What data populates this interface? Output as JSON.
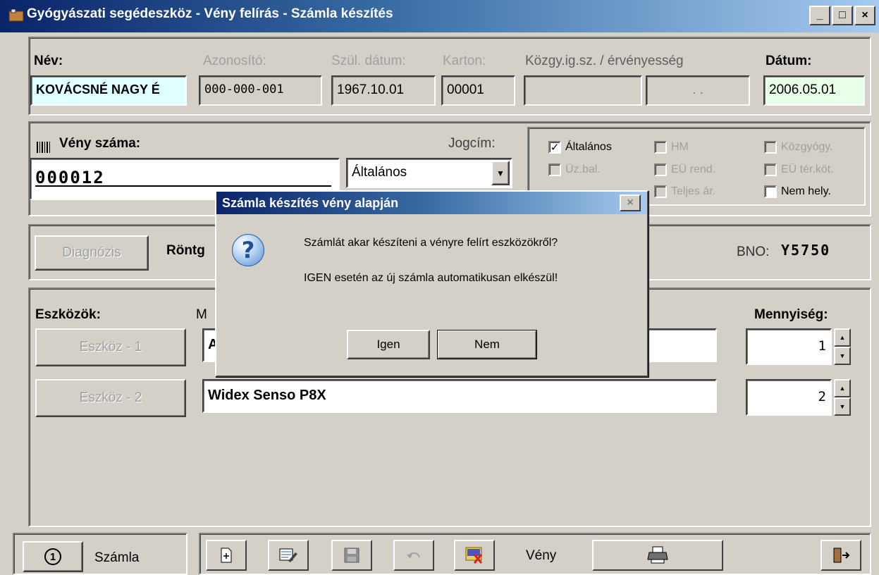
{
  "window": {
    "title": "Gyógyászati segédeszköz - Vény felírás - Számla készítés",
    "minimize_glyph": "_",
    "maximize_glyph": "□",
    "close_glyph": "×"
  },
  "patient": {
    "name_label": "Név:",
    "name_value": "KOVÁCSNÉ NAGY É",
    "id_label": "Azonosító:",
    "id_value": "000-000-001",
    "dob_label": "Szül. dátum:",
    "dob_value": "1967.10.01",
    "card_label": "Karton:",
    "card_value": "00001",
    "kozgy_label": "Közgy.ig.sz. / érvényesség",
    "kozgy_value": "",
    "kozgy_valid_value": ". .",
    "date_label": "Dátum:",
    "date_value": "2006.05.01"
  },
  "veny": {
    "number_label": "Vény száma:",
    "number_value": "000012",
    "jogcim_label": "Jogcím:",
    "jogcim_value": "Általános",
    "checkboxes": [
      {
        "label": "Általános",
        "checked": true,
        "enabled": true
      },
      {
        "label": "HM",
        "checked": false,
        "enabled": false
      },
      {
        "label": "Közgyógy.",
        "checked": false,
        "enabled": false
      },
      {
        "label": "Üz.bal.",
        "checked": false,
        "enabled": false
      },
      {
        "label": "EÜ rend.",
        "checked": false,
        "enabled": false
      },
      {
        "label": "EÜ tér.köt.",
        "checked": false,
        "enabled": false
      },
      {
        "label": "Teljes ár.",
        "checked": false,
        "enabled": false
      },
      {
        "label": "Nem hely.",
        "checked": false,
        "enabled": true
      }
    ]
  },
  "diagnosis": {
    "button_label": "Diagnózis",
    "text": "Röntg",
    "bno_label": "BNO:",
    "bno_value": "Y5750"
  },
  "devices": {
    "label": "Eszközök:",
    "column_label_fragment": "M",
    "quantity_label": "Mennyiség:",
    "items": [
      {
        "button": "Eszköz - 1",
        "name": "A",
        "quantity": "1"
      },
      {
        "button": "Eszköz - 2",
        "name": "Widex Senso P8X",
        "quantity": "2"
      }
    ]
  },
  "bottom": {
    "invoice_number": "1",
    "invoice_label": "Számla",
    "veny_label": "Vény"
  },
  "dialog": {
    "title": "Számla készítés vény alapján",
    "message_line1": "Számlát akar készíteni a vényre felírt eszközökről?",
    "message_line2": "IGEN esetén az új számla automatikusan elkészül!",
    "yes_label": "Igen",
    "no_label": "Nem",
    "icon_glyph": "?"
  }
}
